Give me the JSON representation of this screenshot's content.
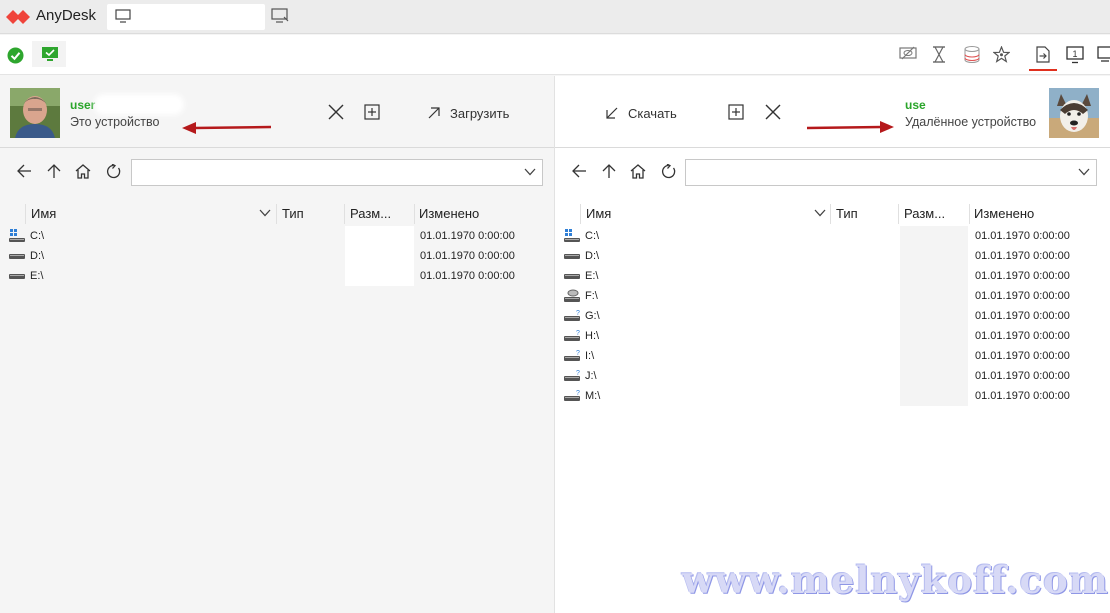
{
  "app": {
    "title": "AnyDesk",
    "brand_color": "#ef443b",
    "tab_label": "",
    "icons": {
      "logo": "anydesk-logo-icon",
      "tab": "monitor-icon",
      "new_tab": "new-tab-monitor-icon"
    }
  },
  "toolbar": {
    "status_color": "#2ea62e",
    "icons": [
      "connection-status-icon",
      "monitor-green-icon",
      "hide-privacy-icon",
      "hourglass-icon",
      "database-icon",
      "favorite-star-icon",
      "file-transfer-icon",
      "display-1-icon",
      "display-icon"
    ],
    "display_number": "1"
  },
  "local": {
    "name": "user",
    "label": "Это устройство",
    "upload_label": "Загрузить",
    "path": "",
    "columns": {
      "name": "Имя",
      "type": "Тип",
      "size": "Разм...",
      "modified": "Изменено"
    },
    "rows": [
      {
        "icon": "windows-drive-icon",
        "name": "C:\\",
        "modified": "01.01.1970 0:00:00"
      },
      {
        "icon": "hard-drive-icon",
        "name": "D:\\",
        "modified": "01.01.1970 0:00:00"
      },
      {
        "icon": "hard-drive-icon",
        "name": "E:\\",
        "modified": "01.01.1970 0:00:00"
      }
    ]
  },
  "remote": {
    "name": "use",
    "label": "Удалённое устройство",
    "download_label": "Скачать",
    "path": "",
    "columns": {
      "name": "Имя",
      "type": "Тип",
      "size": "Разм...",
      "modified": "Изменено"
    },
    "rows": [
      {
        "icon": "windows-drive-icon",
        "name": "C:\\",
        "modified": "01.01.1970 0:00:00"
      },
      {
        "icon": "hard-drive-icon",
        "name": "D:\\",
        "modified": "01.01.1970 0:00:00"
      },
      {
        "icon": "hard-drive-icon",
        "name": "E:\\",
        "modified": "01.01.1970 0:00:00"
      },
      {
        "icon": "cd-drive-icon",
        "name": "F:\\",
        "modified": "01.01.1970 0:00:00"
      },
      {
        "icon": "unknown-drive-icon",
        "name": "G:\\",
        "modified": "01.01.1970 0:00:00"
      },
      {
        "icon": "unknown-drive-icon",
        "name": "H:\\",
        "modified": "01.01.1970 0:00:00"
      },
      {
        "icon": "unknown-drive-icon",
        "name": "I:\\",
        "modified": "01.01.1970 0:00:00"
      },
      {
        "icon": "unknown-drive-icon",
        "name": "J:\\",
        "modified": "01.01.1970 0:00:00"
      },
      {
        "icon": "unknown-drive-icon",
        "name": "M:\\",
        "modified": "01.01.1970 0:00:00"
      }
    ]
  },
  "annotation": {
    "arrow_color": "#b5191b"
  },
  "watermark": "www.melnykoff.com"
}
